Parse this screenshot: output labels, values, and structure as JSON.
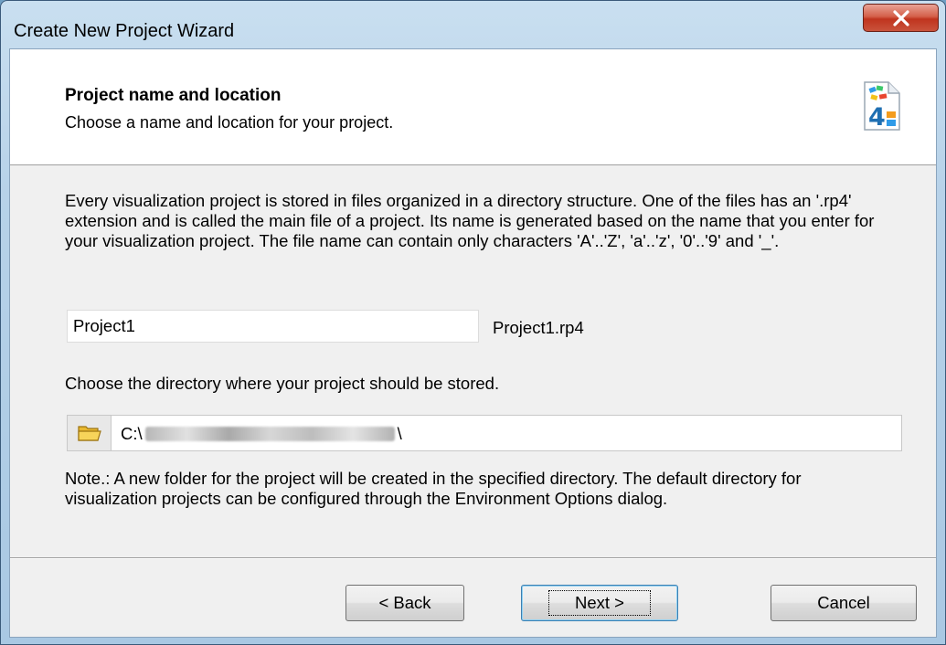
{
  "window": {
    "title": "Create New Project Wizard",
    "close_icon": "close-icon"
  },
  "header": {
    "title": "Project name and location",
    "subtitle": "Choose a name and location for your project.",
    "logo_icon": "rp4-logo-icon"
  },
  "body": {
    "description": "Every visualization project is stored in files organized in a directory structure. One of the files has an '.rp4' extension and is called the main file of a project. Its name is generated based on the name that you enter for your visualization project. The file name can contain only characters 'A'..'Z', 'a'..'z', '0'..'9' and '_'.",
    "project_name_value": "Project1",
    "main_file_name": "Project1.rp4",
    "directory_label": "Choose the directory where your project should be stored.",
    "directory_prefix": "C:\\",
    "directory_suffix": "\\",
    "folder_icon": "folder-icon",
    "note": "Note.: A new folder for the project will be created in the specified directory. The default directory for visualization projects can be configured through the Environment Options dialog."
  },
  "buttons": {
    "back": "< Back",
    "next": "Next >",
    "cancel": "Cancel"
  }
}
